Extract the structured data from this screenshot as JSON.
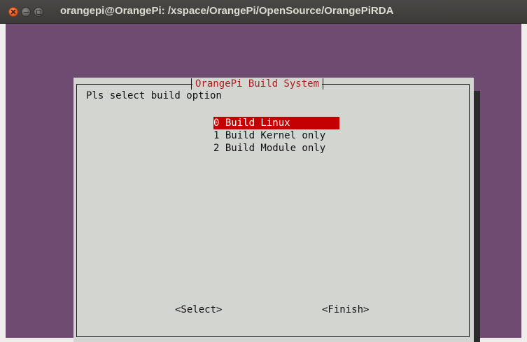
{
  "window": {
    "title": "orangepi@OrangePi: /xspace/OrangePi/OpenSource/OrangePiRDA"
  },
  "dialog": {
    "title": "OrangePi Build System",
    "prompt": "Pls select build option",
    "menu": [
      {
        "label": "0 Build Linux",
        "selected": true
      },
      {
        "label": "1 Build Kernel only",
        "selected": false
      },
      {
        "label": "2 Build Module only",
        "selected": false
      }
    ],
    "buttons": {
      "select": "<Select>",
      "finish": "<Finish>"
    }
  },
  "colors": {
    "terminal_background": "#6f4b72",
    "dialog_background": "#d3d5d0",
    "highlight": "#c50000",
    "title_text": "#b01e1e"
  }
}
